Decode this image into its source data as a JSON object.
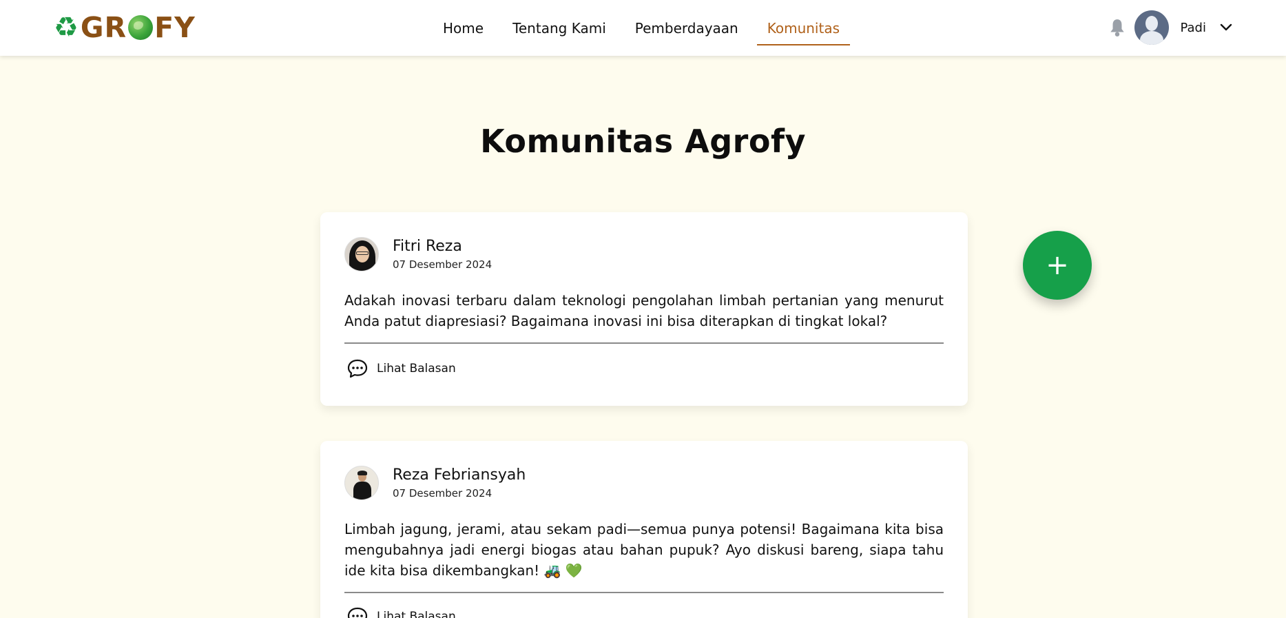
{
  "header": {
    "logo_text": "GROFY",
    "logo_prefix": "A",
    "nav": [
      {
        "label": "Home",
        "active": false
      },
      {
        "label": "Tentang Kami",
        "active": false
      },
      {
        "label": "Pemberdayaan",
        "active": false
      },
      {
        "label": "Komunitas",
        "active": true
      }
    ],
    "user": {
      "name": "Padi",
      "avatar_icon": "user-silhouette-icon"
    },
    "notification_icon": "bell-icon",
    "dropdown_icon": "chevron-down-icon"
  },
  "page": {
    "title": "Komunitas Agrofy"
  },
  "posts": [
    {
      "author": "Fitri Reza",
      "date": "07 Desember 2024",
      "content": "Adakah inovasi terbaru dalam teknologi pengolahan limbah pertanian yang menurut Anda patut diapresiasi? Bagaimana inovasi ini bisa diterapkan di tingkat lokal?",
      "reply_label": "Lihat Balasan"
    },
    {
      "author": "Reza Febriansyah",
      "date": "07 Desember 2024",
      "content": "Limbah jagung, jerami, atau sekam padi—semua punya potensi! Bagaimana kita bisa mengubahnya jadi energi biogas atau bahan pupuk? Ayo diskusi bareng, siapa tahu ide kita bisa dikembangkan! 🚜 💚",
      "reply_label": "Lihat Balasan"
    }
  ],
  "fab": {
    "label": "+"
  },
  "colors": {
    "background": "#fefcee",
    "accent_nav": "#b0611a",
    "fab_green": "#16a04a",
    "logo_brown": "#8a5015",
    "logo_green": "#1f9a45"
  }
}
